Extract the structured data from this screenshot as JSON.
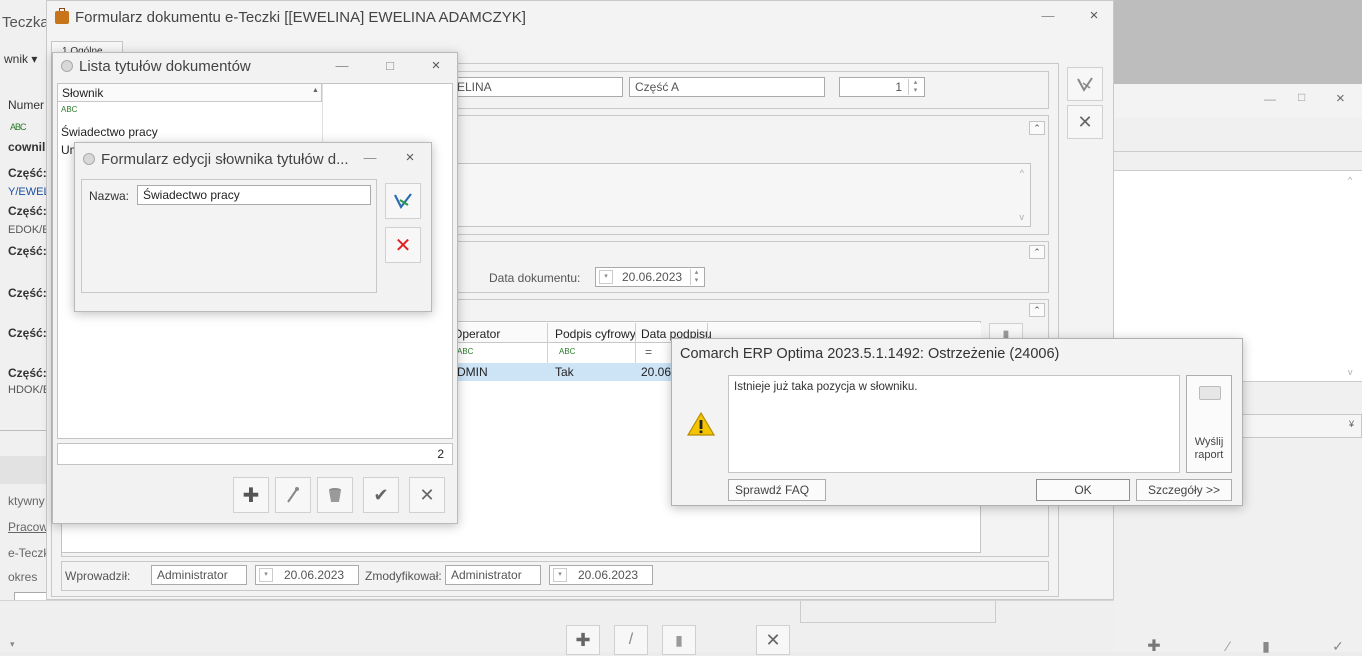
{
  "bg_left_panel": {
    "title_fragment": "Teczka",
    "dropdown_fragment": "wnik ▾",
    "column_numer": "Numer",
    "filter_mark": "ABC",
    "rows": [
      "cownil",
      "Część:",
      "Y/EWEL",
      "Część:",
      "EDOK/E",
      "Część:",
      "Część:",
      "Część:",
      "Część:",
      "HDOK/E"
    ],
    "bottom_labels": [
      "ktywny",
      "Pracown",
      "e-Teczk",
      "okres"
    ]
  },
  "main_form": {
    "title": "Formularz dokumentu e-Teczki [[EWELINA] EWELINA ADAMCZYK]",
    "tab_label": "1 Ogólne",
    "employee_field": "ELINA",
    "part_field": "Część A",
    "part_number": "1",
    "doc_date_label": "Data dokumentu:",
    "doc_date_value": "20.06.2023",
    "grid_headers": [
      "Operator",
      "Podpis cyfrowy",
      "Data podpisu"
    ],
    "grid_filter_row": [
      "ABC",
      "ABC",
      "="
    ],
    "grid_row": [
      "DMIN",
      "Tak",
      "20.06"
    ],
    "introduced_label": "Wprowadził:",
    "introduced_by": "Administrator",
    "introduced_date": "20.06.2023",
    "modified_label": "Zmodyfikował:",
    "modified_by": "Administrator",
    "modified_date": "20.06.2023"
  },
  "list_window": {
    "title": "Lista tytułów dokumentów",
    "column_header": "Słownik",
    "filter_mark": "ABC",
    "items": [
      "Świadectwo pracy",
      "Um"
    ],
    "count": "2"
  },
  "edit_window": {
    "title": "Formularz edycji słownika tytułów d...",
    "name_label": "Nazwa:",
    "name_value": "Świadectwo pracy"
  },
  "warning_dialog": {
    "title": "Comarch ERP Optima 2023.5.1.1492: Ostrzeżenie (24006)",
    "message": "Istnieje już taka pozycja w słowniku.",
    "send_report_label": "Wyślij\nraport",
    "faq_button": "Sprawdź FAQ",
    "ok_button": "OK",
    "details_button": "Szczegóły >>"
  },
  "colors": {
    "accent_blue": "#2b6cb0",
    "selection_blue": "#cde4f7",
    "cancel_red": "#e02020",
    "warning_yellow": "#f5c400"
  }
}
